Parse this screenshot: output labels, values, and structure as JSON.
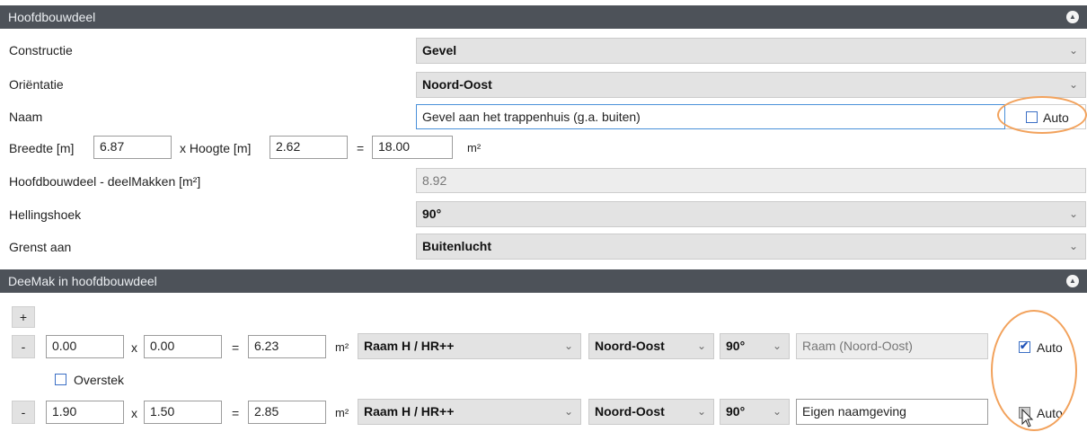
{
  "main_section": {
    "title": "Hoofdbouwdeel",
    "constructie": {
      "label": "Constructie",
      "value": "Gevel"
    },
    "orientatie": {
      "label": "Oriëntatie",
      "value": "Noord-Oost"
    },
    "naam": {
      "label": "Naam",
      "value": "Gevel aan het trappenhuis (g.a. buiten)",
      "auto_label": "Auto",
      "auto_checked": false
    },
    "dimensions": {
      "breedte_label": "Breedte [m]",
      "breedte": "6.87",
      "hoogte_label": "x Hoogte [m]",
      "hoogte": "2.62",
      "equals": "=",
      "area": "18.00",
      "unit": "m²"
    },
    "deelmakken": {
      "label": "Hoofdbouwdeel - deelMakken [m²]",
      "value": "8.92"
    },
    "hellingshoek": {
      "label": "Hellingshoek",
      "value": "90°"
    },
    "grenst_aan": {
      "label": "Grenst aan",
      "value": "Buitenlucht"
    }
  },
  "sub_section": {
    "title": "DeeMak in hoofdbouwdeel",
    "add_label": "+",
    "rows": [
      {
        "remove_label": "-",
        "w": "0.00",
        "times": "x",
        "h": "0.00",
        "equals": "=",
        "area": "6.23",
        "unit": "m²",
        "type": "Raam H / HR++",
        "orientation": "Noord-Oost",
        "angle": "90°",
        "name": "Raam (Noord-Oost)",
        "auto_label": "Auto",
        "auto_checked": true
      },
      {
        "remove_label": "-",
        "w": "1.90",
        "times": "x",
        "h": "1.50",
        "equals": "=",
        "area": "2.85",
        "unit": "m²",
        "type": "Raam H / HR++",
        "orientation": "Noord-Oost",
        "angle": "90°",
        "name": "Eigen naamgeving",
        "auto_label": "Auto",
        "auto_checked": false
      }
    ],
    "overstek_label": "Overstek",
    "overstek_checked": false
  },
  "icons": {
    "collapse": "chevron-up-icon",
    "dropdown": "chevron-down-icon",
    "cursor": "mouse-pointer-icon"
  },
  "colors": {
    "header_bg": "#4d5259",
    "highlight": "#f2a25c",
    "focus": "#4a90d9"
  }
}
